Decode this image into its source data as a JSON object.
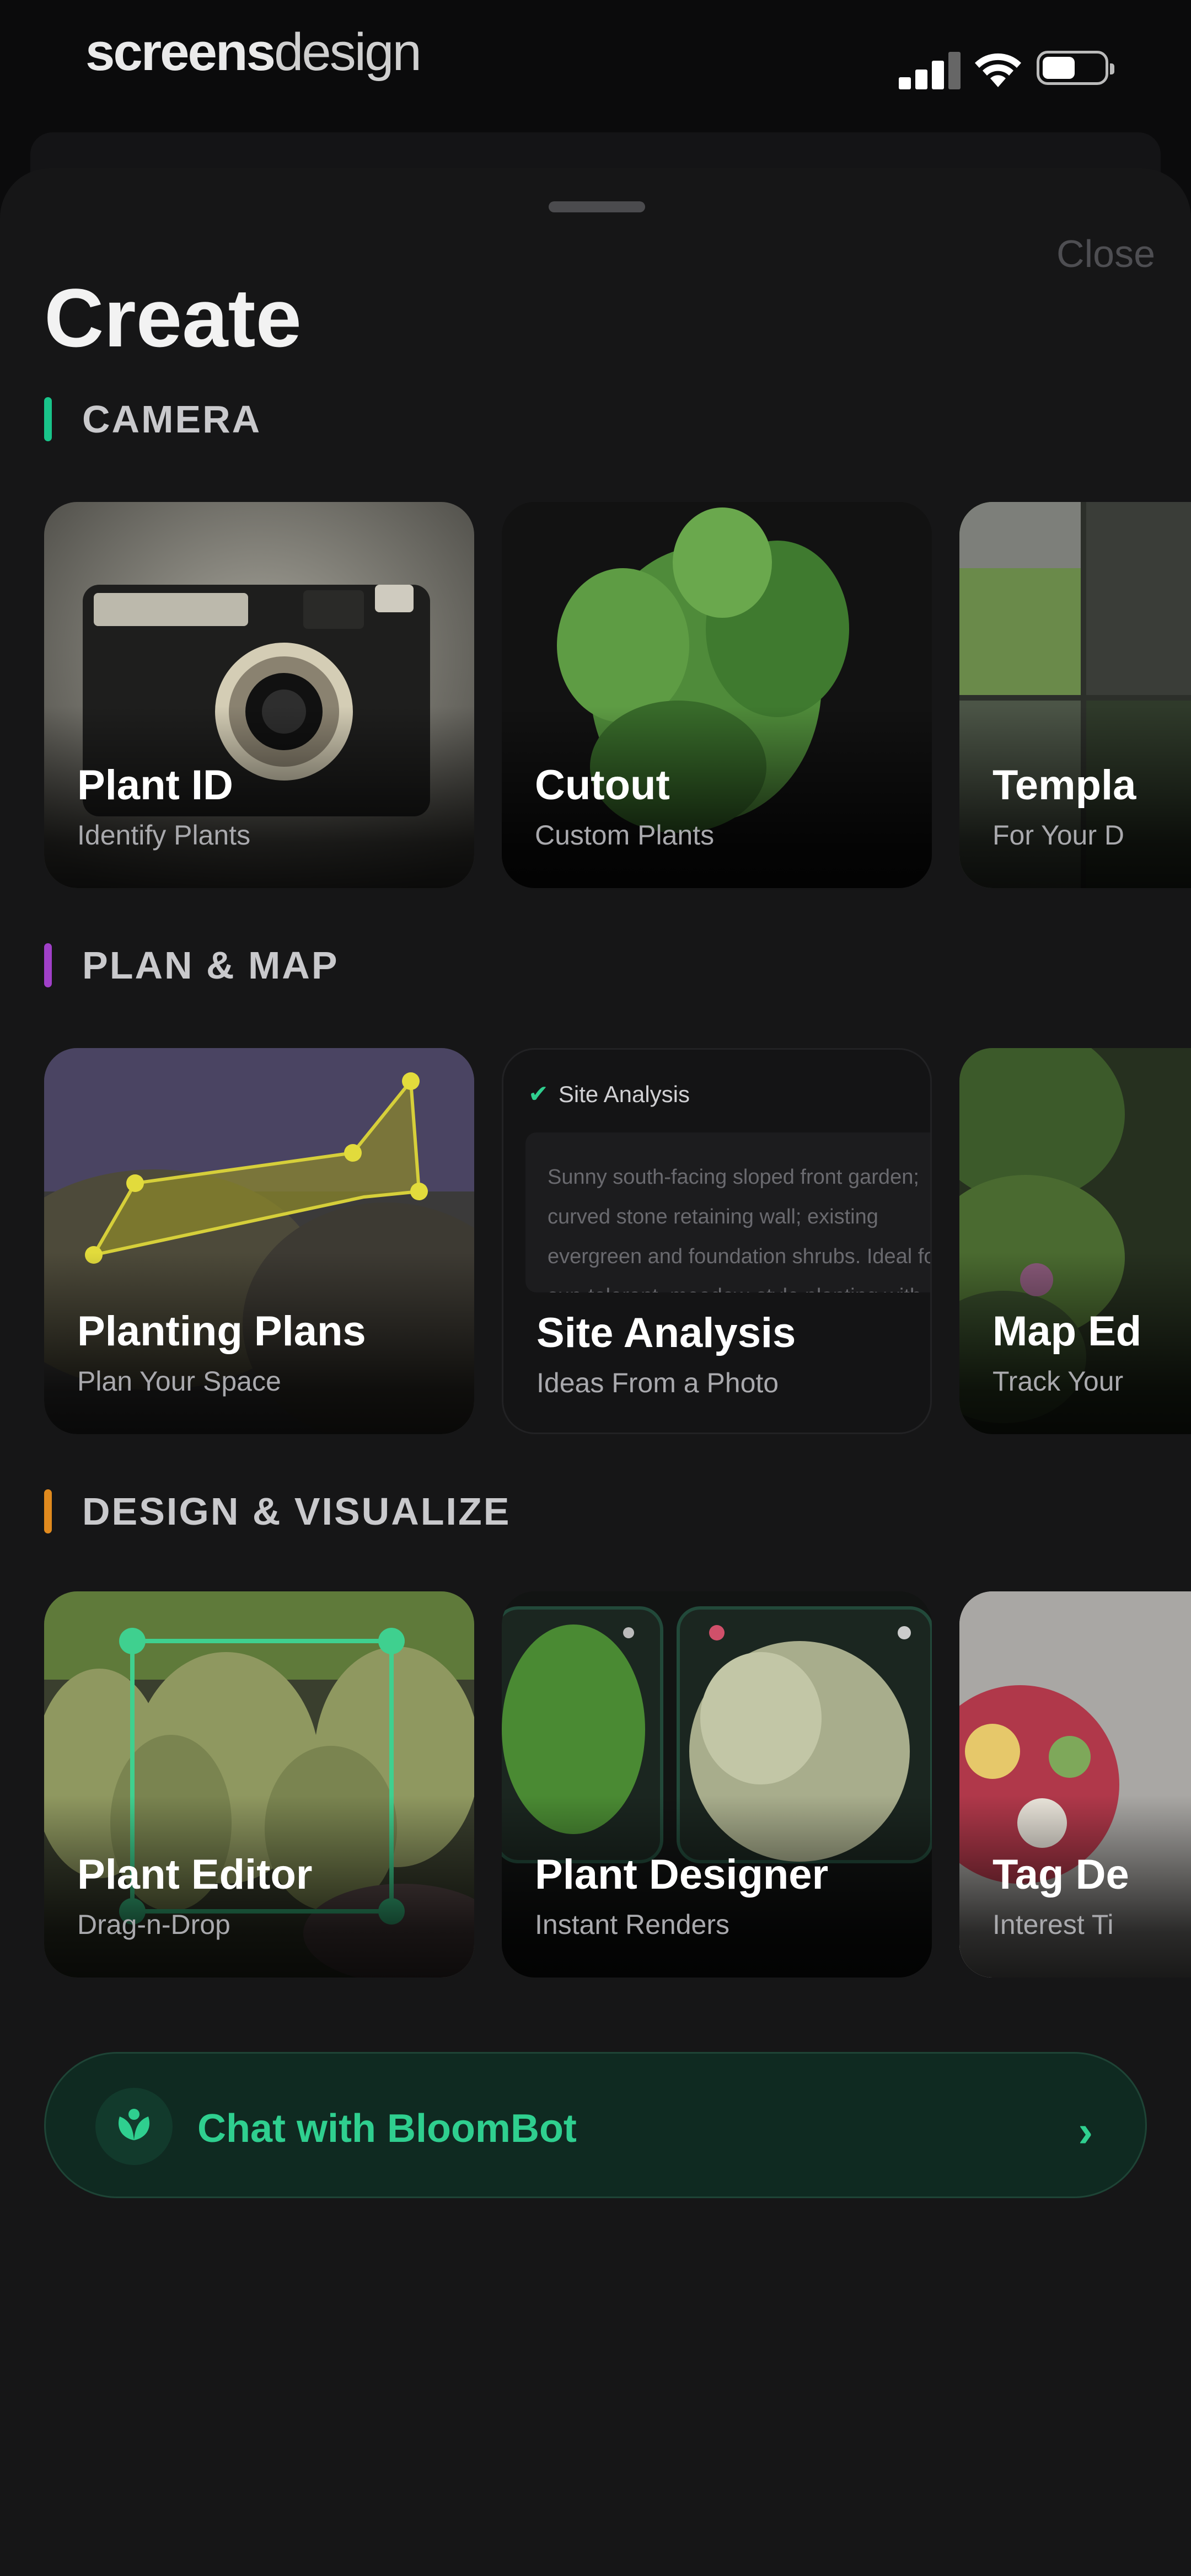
{
  "status_bar": {
    "brand_bold": "screens",
    "brand_light": "design",
    "icons": [
      "cellular-signal-icon",
      "wifi-icon",
      "battery-icon"
    ]
  },
  "sheet": {
    "close_label": "Close",
    "title": "Create"
  },
  "sections": [
    {
      "label": "CAMERA",
      "accent": "#19c48a",
      "cards": [
        {
          "title": "Plant ID",
          "subtitle": "Identify Plants"
        },
        {
          "title": "Cutout",
          "subtitle": "Custom Plants"
        },
        {
          "title": "Templa",
          "subtitle": "For Your D"
        }
      ]
    },
    {
      "label": "PLAN & MAP",
      "accent": "#a040c8",
      "cards": [
        {
          "title": "Planting Plans",
          "subtitle": "Plan Your Space"
        },
        {
          "title": "Site Analysis",
          "subtitle": "Ideas From a Photo",
          "preview_heading": "Site Analysis",
          "preview_text": "Sunny south-facing sloped front garden; curved stone retaining wall; existing evergreen and foundation shrubs. Ideal for a sun-tolerant, meadow-style planting with drought-tolerant perennials"
        },
        {
          "title": "Map Ed",
          "subtitle": "Track Your"
        }
      ]
    },
    {
      "label": "DESIGN & VISUALIZE",
      "accent": "#e08a1e",
      "cards": [
        {
          "title": "Plant Editor",
          "subtitle": "Drag-n-Drop"
        },
        {
          "title": "Plant Designer",
          "subtitle": "Instant Renders"
        },
        {
          "title": "Tag De",
          "subtitle": "Interest Ti"
        }
      ]
    }
  ],
  "chat": {
    "label": "Chat with BloomBot",
    "accent": "#2fcf8f"
  }
}
